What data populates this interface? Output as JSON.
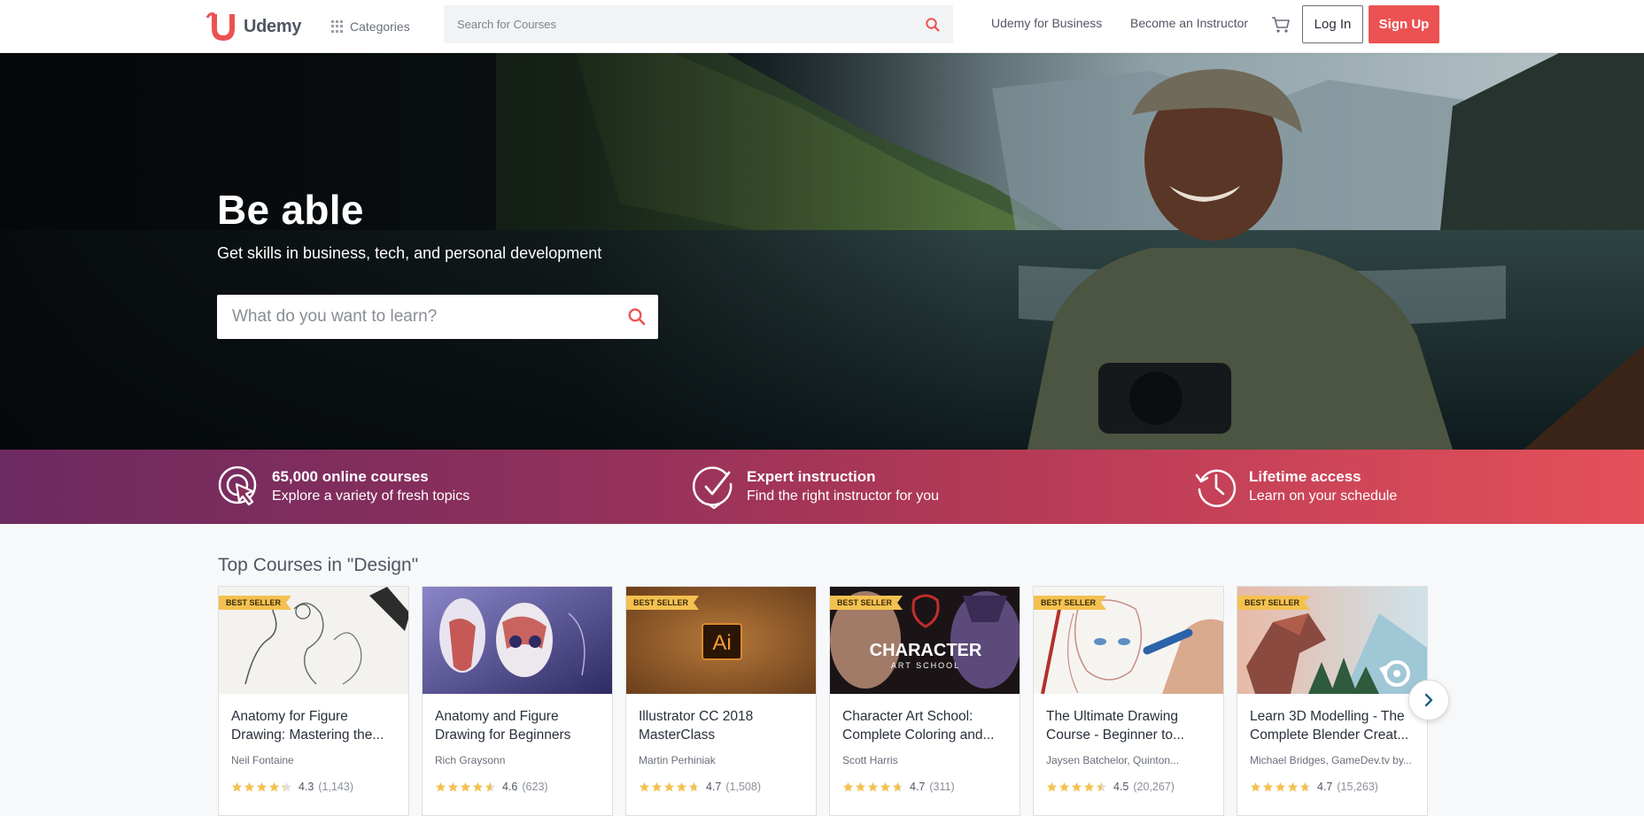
{
  "brand": {
    "name": "Udemy",
    "logo_color": "#ec5252"
  },
  "header": {
    "categories_label": "Categories",
    "search_placeholder": "Search for Courses",
    "business_link": "Udemy for Business",
    "instructor_link": "Become an Instructor",
    "login_label": "Log In",
    "signup_label": "Sign Up",
    "accent": "#ec5252"
  },
  "hero": {
    "title": "Be able",
    "subtitle": "Get skills in business, tech, and personal development",
    "search_placeholder": "What do you want to learn?"
  },
  "features": [
    {
      "icon": "cursor-target-icon",
      "title": "65,000 online courses",
      "subtitle": "Explore a variety of fresh topics"
    },
    {
      "icon": "check-badge-icon",
      "title": "Expert instruction",
      "subtitle": "Find the right instructor for you"
    },
    {
      "icon": "history-clock-icon",
      "title": "Lifetime access",
      "subtitle": "Learn on your schedule"
    }
  ],
  "courses_section": {
    "title": "Top Courses in \"Design\"",
    "badge_label": "BEST SELLER",
    "courses": [
      {
        "title_line1": "Anatomy for Figure",
        "title_line2": "Drawing: Mastering the...",
        "author": "Neil Fontaine",
        "rating": "4.3",
        "count": "(1,143)",
        "bestseller": true
      },
      {
        "title_line1": "Anatomy and Figure",
        "title_line2": "Drawing for Beginners",
        "author": "Rich Graysonn",
        "rating": "4.6",
        "count": "(623)",
        "bestseller": false
      },
      {
        "title_line1": "Illustrator CC 2018",
        "title_line2": "MasterClass",
        "author": "Martin Perhiniak",
        "rating": "4.7",
        "count": "(1,508)",
        "bestseller": true,
        "thumb_text": "Ai"
      },
      {
        "title_line1": "Character Art School:",
        "title_line2": "Complete Coloring and...",
        "author": "Scott Harris",
        "rating": "4.7",
        "count": "(311)",
        "bestseller": true,
        "thumb_text": "CHARACTER",
        "thumb_sub": "ART SCHOOL"
      },
      {
        "title_line1": "The Ultimate Drawing",
        "title_line2": "Course - Beginner to...",
        "author": "Jaysen Batchelor, Quinton...",
        "rating": "4.5",
        "count": "(20,267)",
        "bestseller": true
      },
      {
        "title_line1": "Learn 3D Modelling - The",
        "title_line2": "Complete Blender Creat...",
        "author": "Michael Bridges, GameDev.tv by...",
        "rating": "4.7",
        "count": "(15,263)",
        "bestseller": true
      }
    ]
  },
  "icons": {
    "search": "search-icon",
    "cart": "cart-icon",
    "categories": "grid-icon",
    "next": "chevron-right-icon",
    "star": "star-icon"
  }
}
